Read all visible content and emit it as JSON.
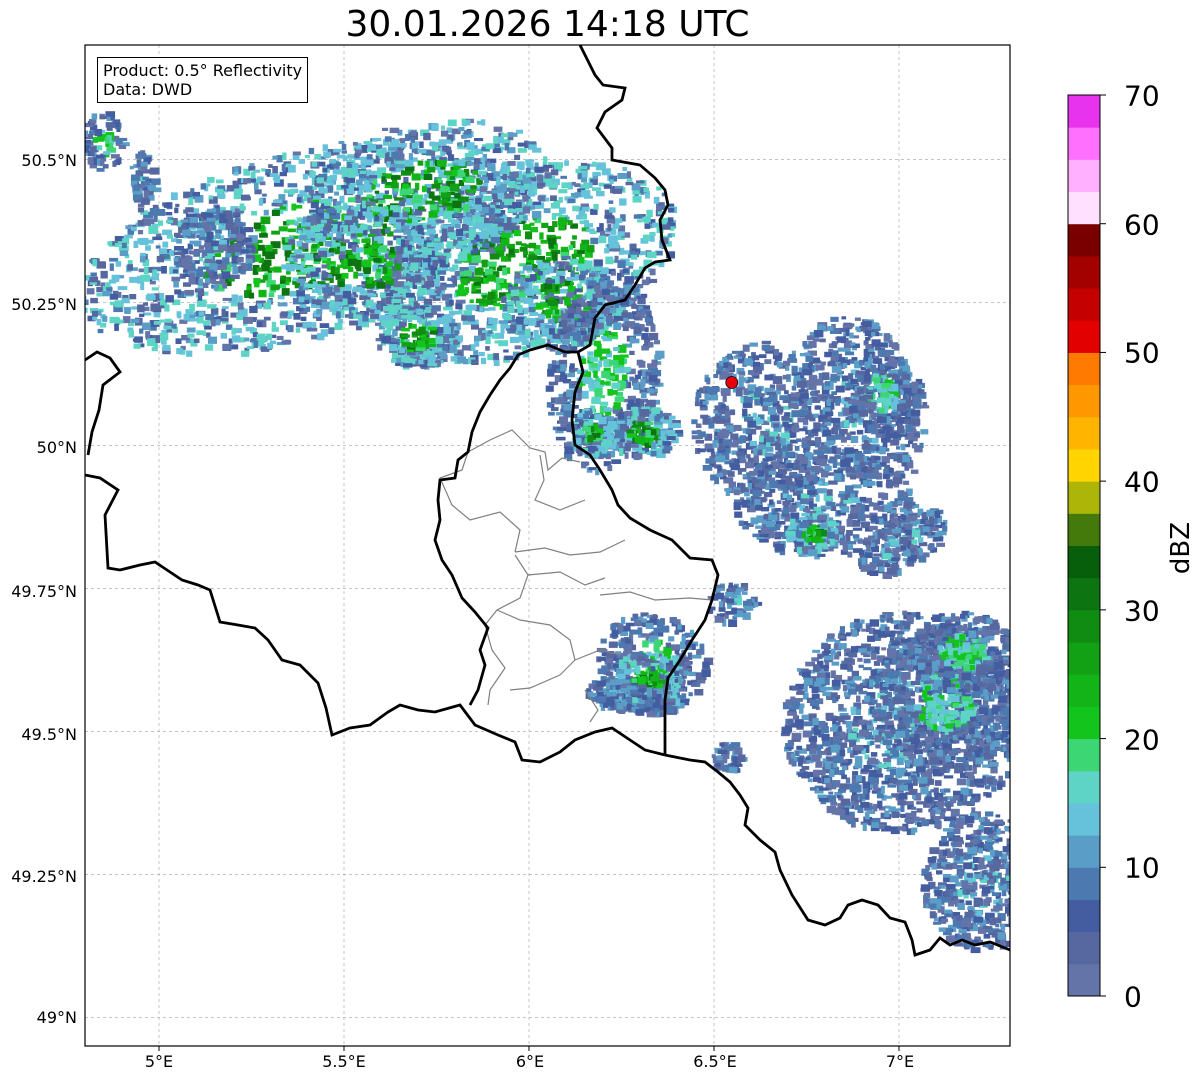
{
  "title": "30.01.2026 14:18 UTC",
  "info": {
    "product": "Product: 0.5° Reflectivity",
    "source": "Data: DWD"
  },
  "map": {
    "lon_range": [
      4.8,
      7.3
    ],
    "lat_range": [
      48.95,
      50.7
    ],
    "lat_ticks": [
      "50.5°N",
      "50.25°N",
      "50°N",
      "49.75°N",
      "49.5°N",
      "49.25°N",
      "49°N"
    ],
    "lon_ticks": [
      "5°E",
      "5.5°E",
      "6°E",
      "6.5°E",
      "7°E"
    ],
    "grid": true,
    "radar_site": {
      "lon": 6.548,
      "lat": 50.11,
      "color": "#e8000b"
    },
    "boundary_color": "#000000",
    "admin_color": "#808080"
  },
  "colorbar": {
    "label": "dBZ",
    "min": 0,
    "max": 70,
    "ticks": [
      "0",
      "10",
      "20",
      "30",
      "40",
      "50",
      "60",
      "70"
    ],
    "colors": [
      "#6474a8",
      "#56689f",
      "#445ca0",
      "#4c7ab0",
      "#5a9ec8",
      "#66c2da",
      "#5ed4c6",
      "#3dd674",
      "#13c41d",
      "#13b417",
      "#12a015",
      "#108c12",
      "#0c7410",
      "#075e0b",
      "#447a0b",
      "#adb508",
      "#ffd400",
      "#ffb400",
      "#ff9700",
      "#ff7a00",
      "#e30000",
      "#c40000",
      "#a30000",
      "#7a0000",
      "#ffe1ff",
      "#ffb1ff",
      "#ff70ff",
      "#e833ee"
    ]
  }
}
